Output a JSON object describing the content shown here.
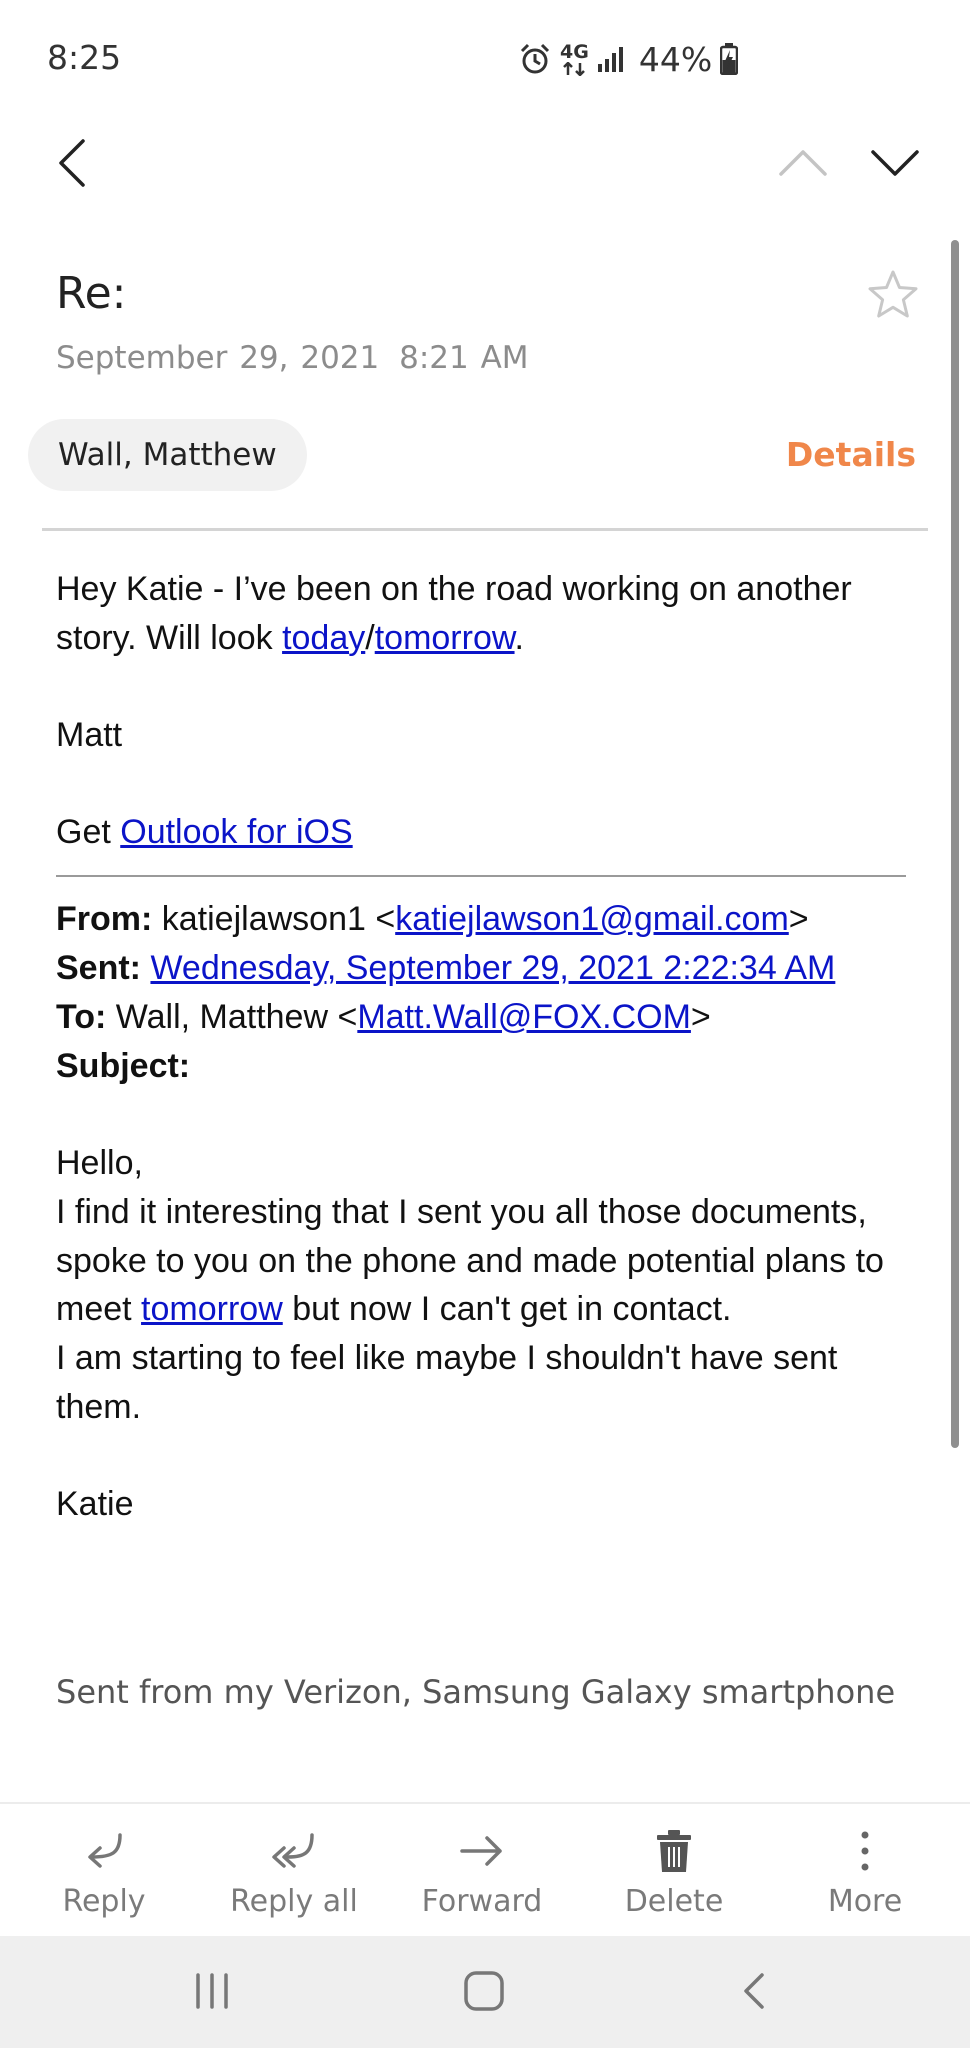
{
  "status_bar": {
    "time": "8:25",
    "network": "4G",
    "battery": "44%"
  },
  "email": {
    "subject": "Re:",
    "date": "September 29, 2021",
    "time": "8:21 AM",
    "sender_chip": "Wall, Matthew",
    "details_label": "Details",
    "accent_color": "#f0874a",
    "body": {
      "p1_start": "Hey Katie - I’ve been on the road working on another story. Will look ",
      "link_today": "today",
      "slash": "/",
      "link_tomorrow": "tomorrow",
      "p1_end": ".",
      "sign_off": "Matt",
      "get_prefix": "Get ",
      "link_outlook": "Outlook for iOS"
    },
    "quoted": {
      "from_label": "From:",
      "from_name": " katiejlawson1 <",
      "from_email": "katiejlawson1@gmail.com",
      "from_close": ">",
      "sent_label": "Sent:",
      "sent_value": "Wednesday, September 29, 2021 2:22:34 AM",
      "to_label": "To:",
      "to_name": " Wall, Matthew <",
      "to_email": "Matt.Wall@FOX.COM",
      "to_close": ">",
      "subject_label": "Subject:",
      "greeting": "Hello,",
      "line1": " I find it interesting that I sent you all those documents, spoke to you on the phone and made potential plans to meet ",
      "link_tomorrow": "tomorrow",
      "line1_end": " but now I can't get in contact.",
      "line2": "I am starting to feel like maybe I shouldn't have sent them.",
      "sign_off": "Katie",
      "signature": "Sent from my Verizon, Samsung Galaxy smartphone"
    }
  },
  "actions": {
    "reply": "Reply",
    "reply_all": "Reply all",
    "forward": "Forward",
    "delete": "Delete",
    "more": "More"
  },
  "icons": {
    "back": "back-arrow-icon",
    "prev": "chevron-up-icon",
    "next": "chevron-down-icon",
    "star": "star-icon"
  }
}
